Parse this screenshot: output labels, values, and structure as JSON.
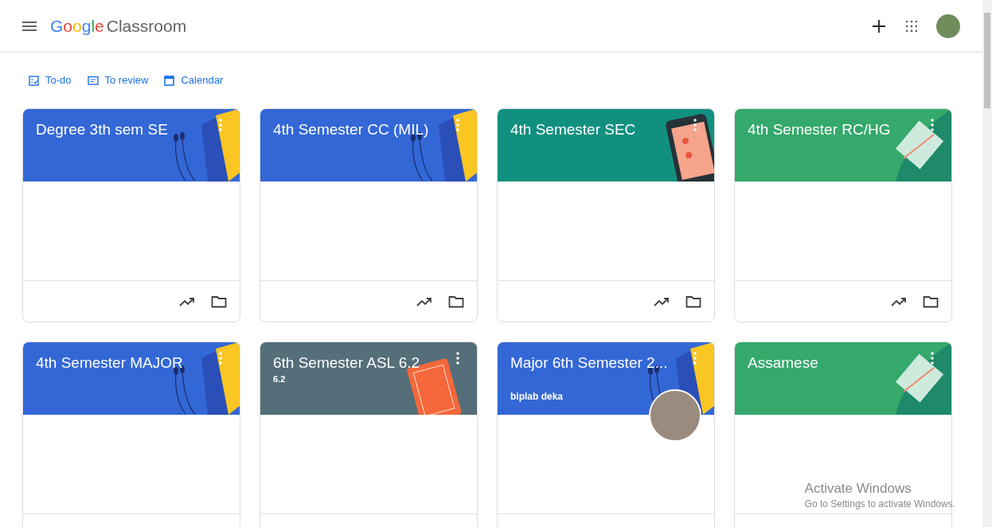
{
  "header": {
    "brand": "Google",
    "product": "Classroom"
  },
  "nav": [
    {
      "kind": "todo",
      "label": "To-do"
    },
    {
      "kind": "review",
      "label": "To review"
    },
    {
      "kind": "calendar",
      "label": "Calendar"
    }
  ],
  "classes": [
    {
      "title": "Degree 3th sem SE",
      "kind": "headphones",
      "color": "#3367d6"
    },
    {
      "title": "4th Semester CC (MIL)",
      "kind": "headphones",
      "color": "#3367d6"
    },
    {
      "title": "4th Semester SEC",
      "kind": "phone",
      "color": "#12907f"
    },
    {
      "title": "4th Semester RC/HG",
      "kind": "paper",
      "color": "#34a96b"
    },
    {
      "title": "4th Semester MAJOR",
      "kind": "headphones",
      "color": "#3367d6"
    },
    {
      "title": "6th Semester ASL 6.2",
      "subtitle": "6.2",
      "kind": "book",
      "color": "#546e7a"
    },
    {
      "title": "Major 6th Semester 2...",
      "teacher": "biplab deka",
      "kind": "headphones",
      "color": "#3367d6"
    },
    {
      "title": "Assamese",
      "kind": "paper",
      "color": "#34a96b"
    }
  ],
  "os_notice": {
    "title": "Activate Windows",
    "message": "Go to Settings to activate Windows."
  }
}
